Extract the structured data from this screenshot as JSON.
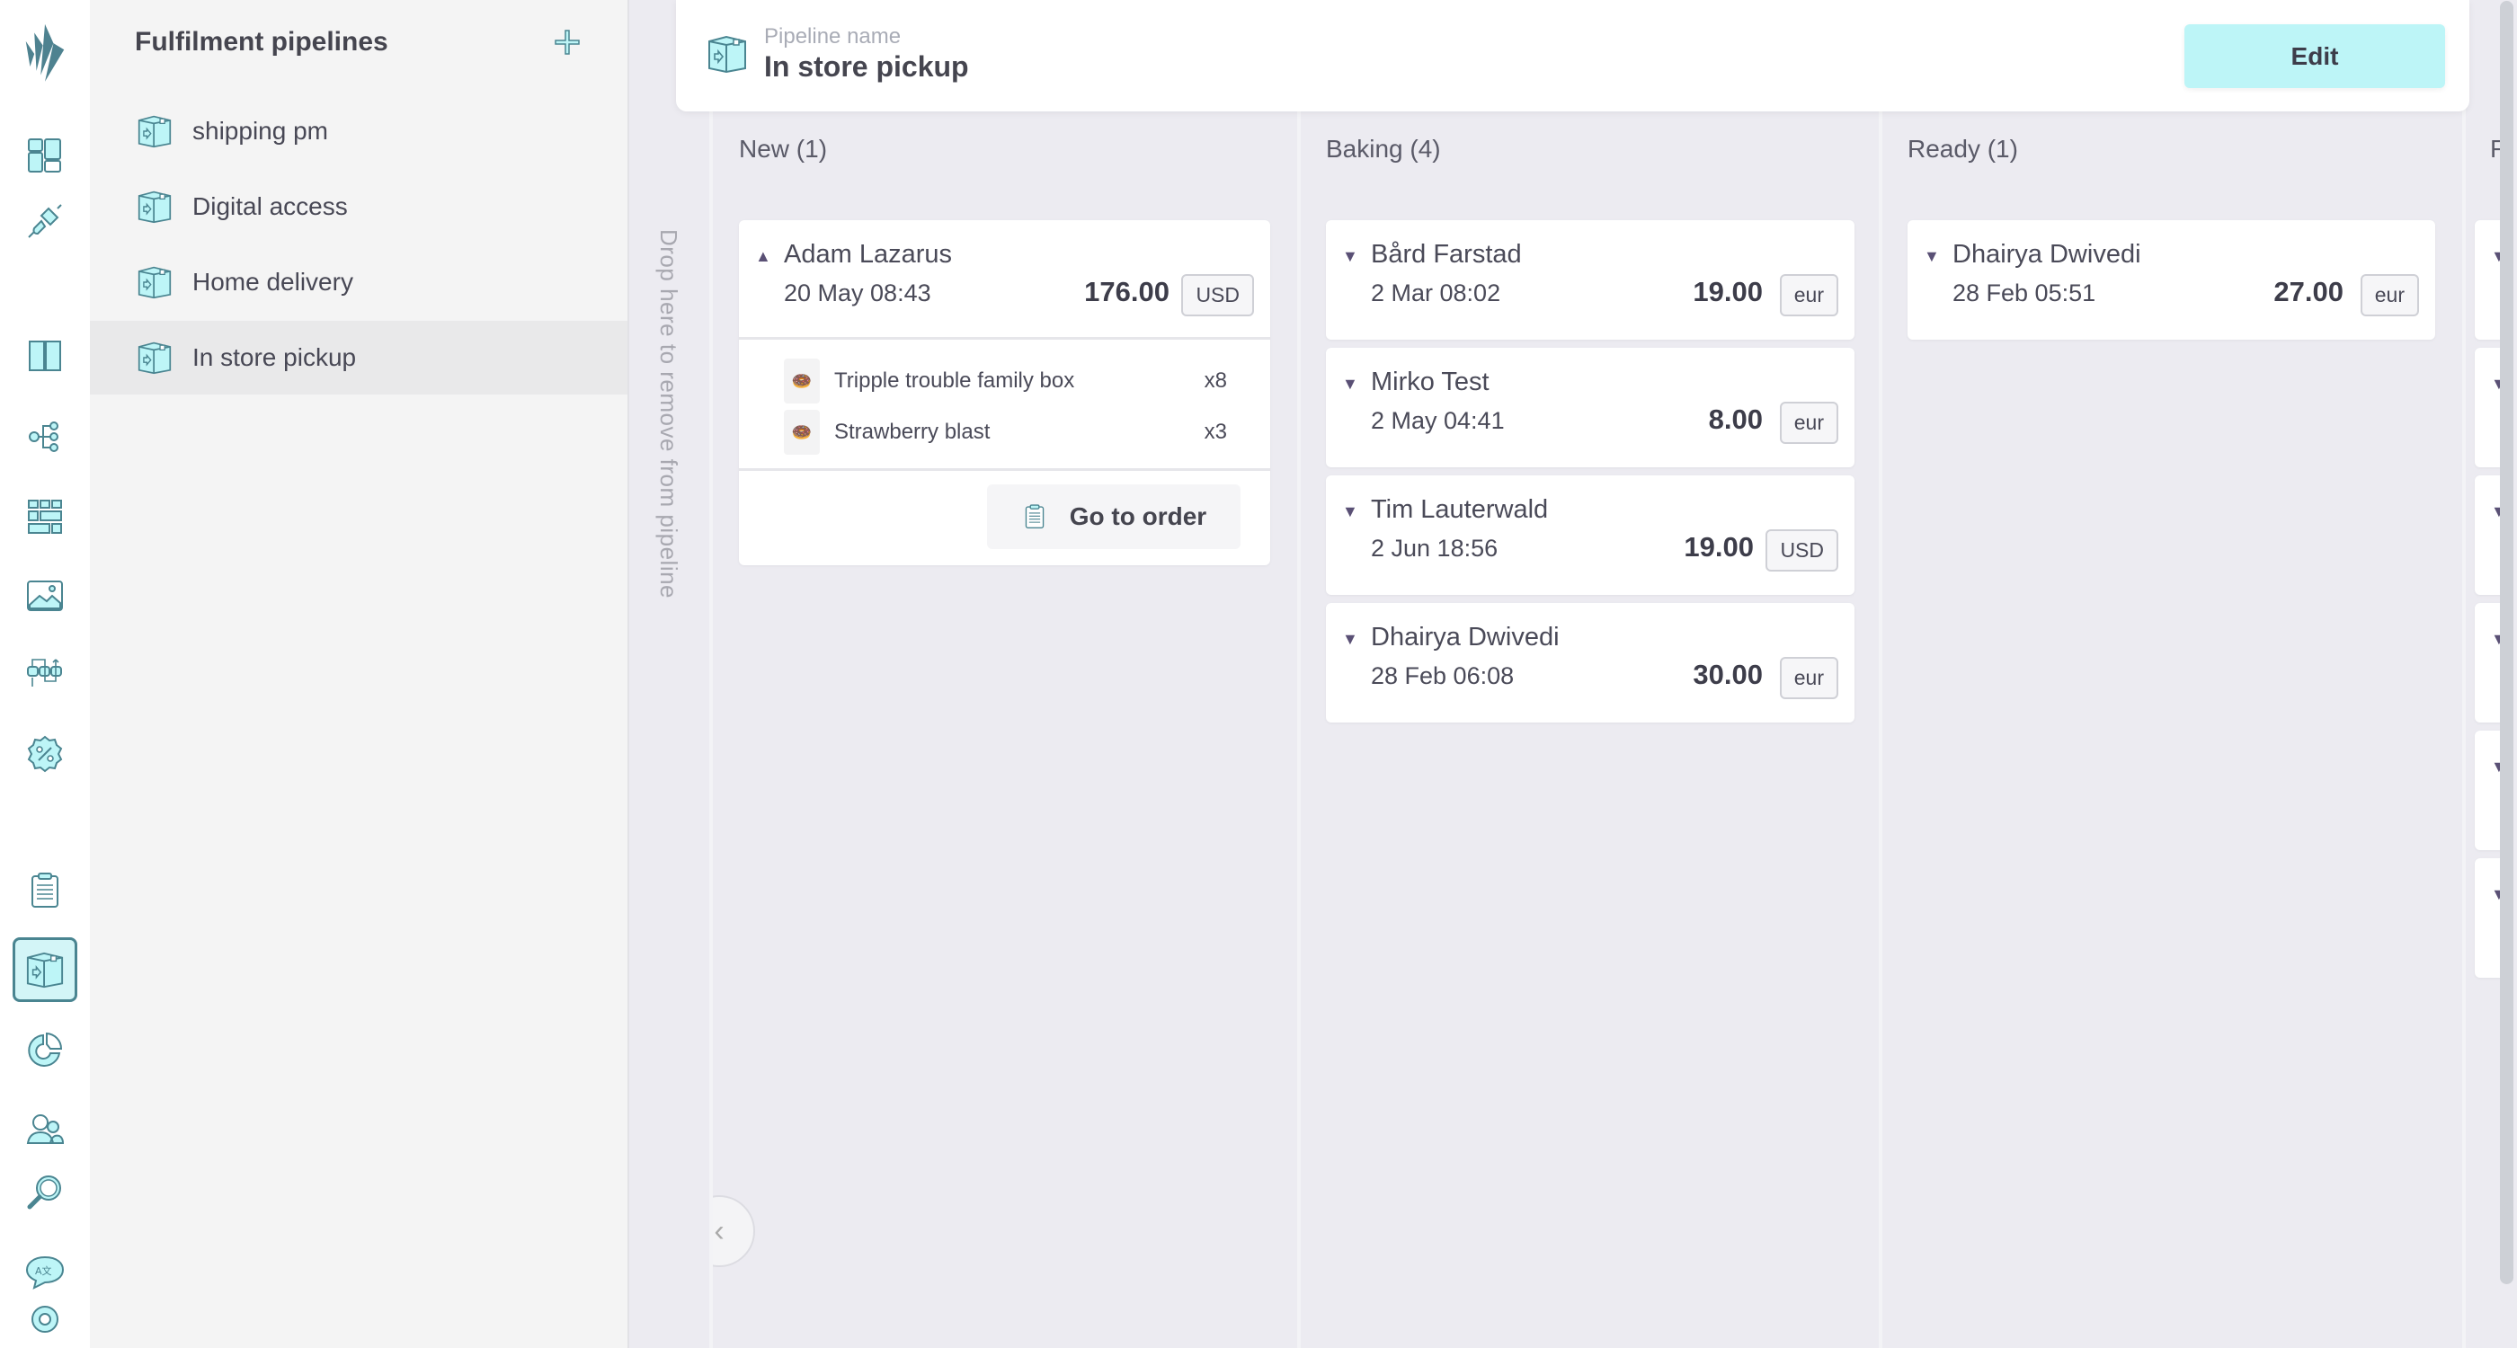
{
  "colors": {
    "accent": "#bdf5f7",
    "icon_stroke": "#4a8591",
    "logo": "#4e8290"
  },
  "rail": {
    "items": [
      {
        "icon": "dashboard-icon",
        "selected": false
      },
      {
        "icon": "plug-icon",
        "selected": false
      },
      {
        "icon": "book-icon",
        "selected": false
      },
      {
        "icon": "tree-icon",
        "selected": false
      },
      {
        "icon": "grid-icon",
        "selected": false
      },
      {
        "icon": "image-icon",
        "selected": false
      },
      {
        "icon": "flow-icon",
        "selected": false
      },
      {
        "icon": "discount-icon",
        "selected": false
      },
      {
        "icon": "clipboard-icon",
        "selected": false
      },
      {
        "icon": "box-icon",
        "selected": true
      },
      {
        "icon": "pie-chart-icon",
        "selected": false
      },
      {
        "icon": "users-icon",
        "selected": false
      },
      {
        "icon": "search-icon",
        "selected": false
      },
      {
        "icon": "translate-icon",
        "selected": false
      },
      {
        "icon": "gear-icon",
        "selected": false
      }
    ]
  },
  "sidebar": {
    "title": "Fulfilment pipelines",
    "items": [
      {
        "label": "shipping pm",
        "selected": false
      },
      {
        "label": "Digital access",
        "selected": false
      },
      {
        "label": "Home delivery",
        "selected": false
      },
      {
        "label": "In store pickup",
        "selected": true
      }
    ]
  },
  "dropzone": {
    "text": "Drop here to remove from pipeline"
  },
  "header": {
    "label": "Pipeline name",
    "title": "In store pickup",
    "edit_label": "Edit"
  },
  "columns": [
    {
      "title": "New (1)",
      "cards": [
        {
          "name": "Adam Lazarus",
          "date": "20 May 08:43",
          "amount": "176.00",
          "currency": "USD",
          "expanded": true,
          "lines": [
            {
              "name": "Tripple trouble family box",
              "qty": "x8"
            },
            {
              "name": "Strawberry blast",
              "qty": "x3"
            }
          ],
          "action": "Go to order"
        }
      ]
    },
    {
      "title": "Baking (4)",
      "cards": [
        {
          "name": "Bård Farstad",
          "date": "2 Mar 08:02",
          "amount": "19.00",
          "currency": "eur"
        },
        {
          "name": "Mirko Test",
          "date": "2 May 04:41",
          "amount": "8.00",
          "currency": "eur"
        },
        {
          "name": "Tim Lauterwald",
          "date": "2 Jun 18:56",
          "amount": "19.00",
          "currency": "USD"
        },
        {
          "name": "Dhairya Dwivedi",
          "date": "28 Feb 06:08",
          "amount": "30.00",
          "currency": "eur"
        }
      ]
    },
    {
      "title": "Ready (1)",
      "cards": [
        {
          "name": "Dhairya Dwivedi",
          "date": "28 Feb 05:51",
          "amount": "27.00",
          "currency": "eur"
        }
      ]
    },
    {
      "title": "F",
      "cards": [
        {},
        {},
        {},
        {},
        {},
        {}
      ]
    }
  ]
}
